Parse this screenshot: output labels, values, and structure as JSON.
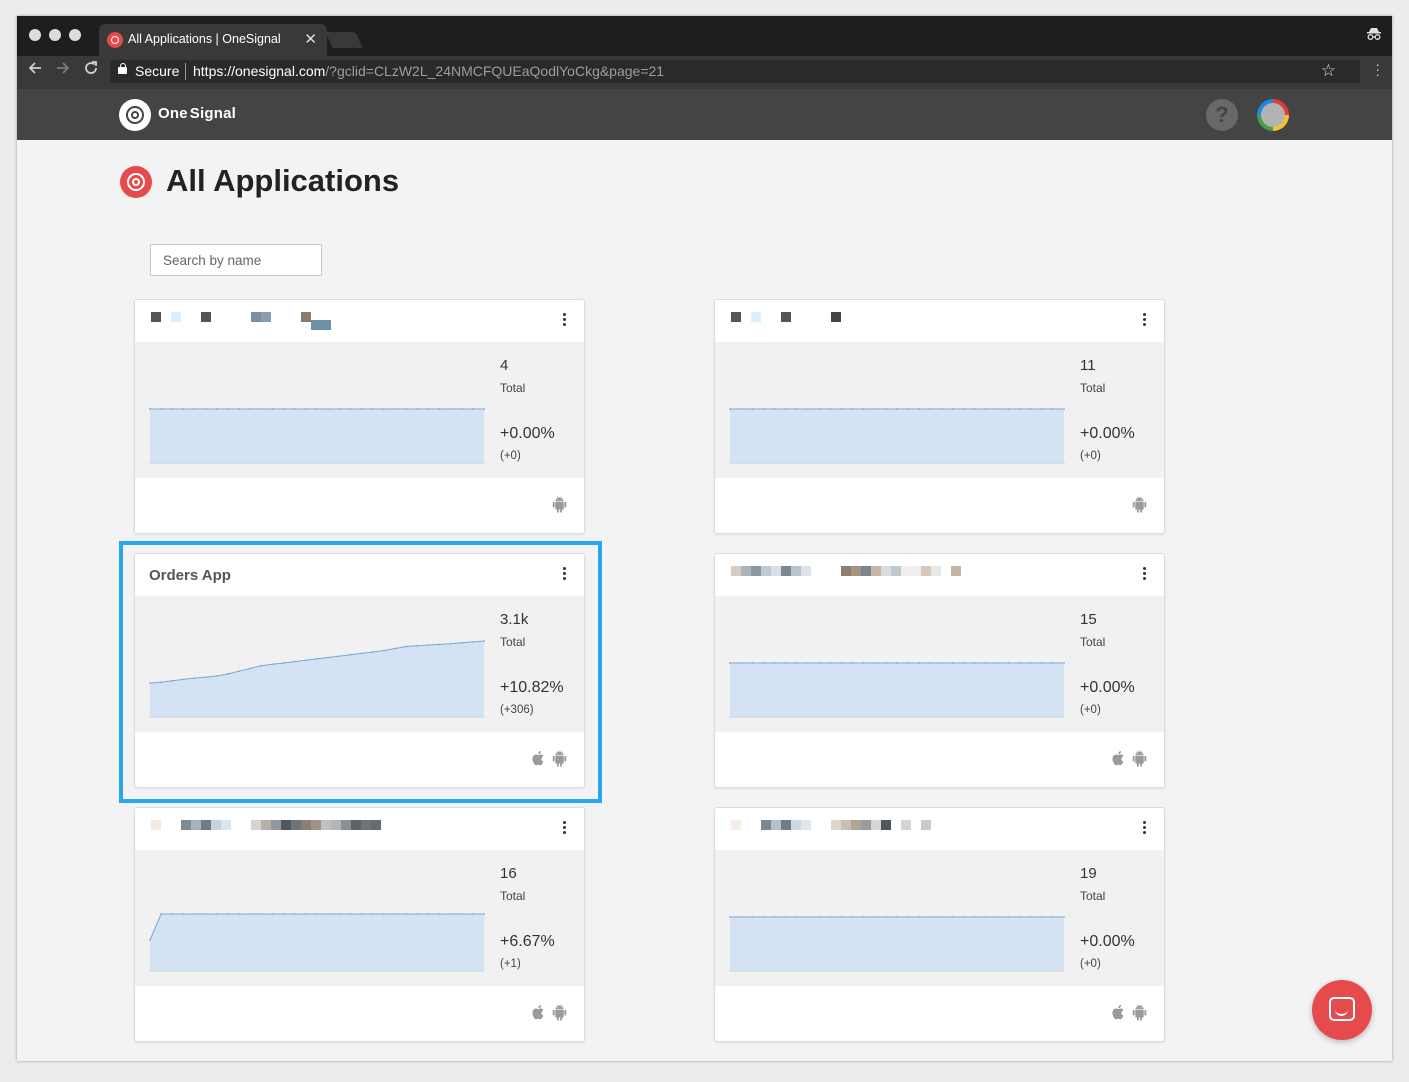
{
  "browser": {
    "tab_title": "All Applications | OneSignal",
    "tab_close": "✕",
    "secure_label": "Secure",
    "url_host": "https://onesignal.com",
    "url_rest": "/?gclid=CLzW2L_24NMCFQUEaQodlYoCkg&page=21"
  },
  "header": {
    "brand_prefix": "One",
    "brand_suffix": "Signal",
    "help_label": "?"
  },
  "page": {
    "title": "All Applications",
    "search_placeholder": "Search by name"
  },
  "colors": {
    "brand_red": "#e54b4d",
    "highlight_blue": "#28a8ea",
    "chart_fill": "#d4e3f4",
    "chart_line": "#7aa8d8"
  },
  "apps": [
    {
      "name": "",
      "name_hidden": true,
      "total": "4",
      "total_label": "Total",
      "change_pct": "+0.00%",
      "change_abs": "(+0)",
      "platforms": [
        "android-icon"
      ],
      "trend": [
        4,
        4,
        4,
        4,
        4,
        4,
        4,
        4,
        4,
        4,
        4,
        4,
        4,
        4,
        4,
        4,
        4,
        4,
        4,
        4,
        4,
        4,
        4,
        4,
        4,
        4,
        4,
        4,
        4,
        4,
        4
      ]
    },
    {
      "name": "",
      "name_hidden": true,
      "total": "11",
      "total_label": "Total",
      "change_pct": "+0.00%",
      "change_abs": "(+0)",
      "platforms": [
        "android-icon"
      ],
      "trend": [
        11,
        11,
        11,
        11,
        11,
        11,
        11,
        11,
        11,
        11,
        11,
        11,
        11,
        11,
        11,
        11,
        11,
        11,
        11,
        11,
        11,
        11,
        11,
        11,
        11,
        11,
        11,
        11,
        11,
        11,
        11
      ]
    },
    {
      "name": "Orders App",
      "name_hidden": false,
      "total": "3.1k",
      "total_label": "Total",
      "change_pct": "+10.82%",
      "change_abs": "(+306)",
      "platforms": [
        "apple-icon",
        "android-icon"
      ],
      "trend": [
        2829,
        2835,
        2845,
        2855,
        2865,
        2872,
        2880,
        2895,
        2915,
        2935,
        2955,
        2965,
        2975,
        2985,
        2995,
        3005,
        3015,
        3025,
        3035,
        3045,
        3055,
        3065,
        3080,
        3095,
        3100,
        3105,
        3110,
        3115,
        3122,
        3128,
        3135
      ]
    },
    {
      "name": "",
      "name_hidden": true,
      "total": "15",
      "total_label": "Total",
      "change_pct": "+0.00%",
      "change_abs": "(+0)",
      "platforms": [
        "apple-icon",
        "android-icon"
      ],
      "trend": [
        15,
        15,
        15,
        15,
        15,
        15,
        15,
        15,
        15,
        15,
        15,
        15,
        15,
        15,
        15,
        15,
        15,
        15,
        15,
        15,
        15,
        15,
        15,
        15,
        15,
        15,
        15,
        15,
        15,
        15,
        15
      ]
    },
    {
      "name": "",
      "name_hidden": true,
      "total": "16",
      "total_label": "Total",
      "change_pct": "+6.67%",
      "change_abs": "(+1)",
      "platforms": [
        "apple-icon",
        "android-icon"
      ],
      "trend": [
        15,
        16,
        16,
        16,
        16,
        16,
        16,
        16,
        16,
        16,
        16,
        16,
        16,
        16,
        16,
        16,
        16,
        16,
        16,
        16,
        16,
        16,
        16,
        16,
        16,
        16,
        16,
        16,
        16,
        16,
        16
      ]
    },
    {
      "name": "",
      "name_hidden": true,
      "total": "19",
      "total_label": "Total",
      "change_pct": "+0.00%",
      "change_abs": "(+0)",
      "platforms": [
        "apple-icon",
        "android-icon"
      ],
      "trend": [
        19,
        19,
        19,
        19,
        19,
        19,
        19,
        19,
        19,
        19,
        19,
        19,
        19,
        19,
        19,
        19,
        19,
        19,
        19,
        19,
        19,
        19,
        19,
        19,
        19,
        19,
        19,
        19,
        19,
        19,
        19
      ]
    }
  ]
}
